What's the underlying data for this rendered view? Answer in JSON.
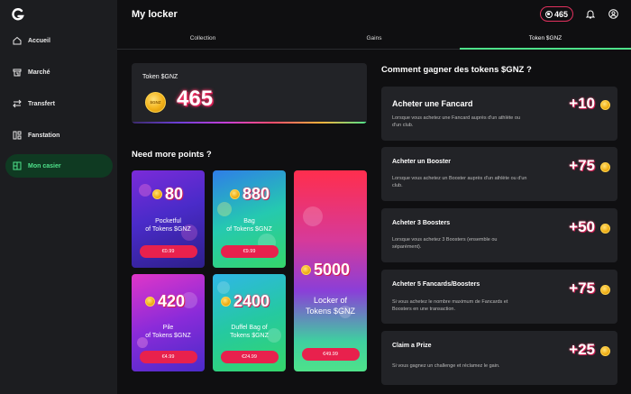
{
  "header": {
    "title": "My locker",
    "token_balance": "465"
  },
  "sidebar": {
    "items": [
      {
        "label": "Accueil",
        "icon": "home-icon"
      },
      {
        "label": "Marché",
        "icon": "market-icon"
      },
      {
        "label": "Transfert",
        "icon": "transfer-icon"
      },
      {
        "label": "Fanstation",
        "icon": "fanstation-icon"
      },
      {
        "label": "Mon casier",
        "icon": "locker-icon",
        "active": true
      }
    ]
  },
  "tabs": [
    {
      "label": "Collection"
    },
    {
      "label": "Gains"
    },
    {
      "label": "Token $GNZ",
      "active": true
    }
  ],
  "token_box": {
    "label": "Token $GNZ",
    "value": "465",
    "coin_text": "$GNZ"
  },
  "packs_title": "Need more points ?",
  "packs": [
    {
      "amount": "80",
      "name_line1": "Pocketful",
      "name_line2": "of Tokens $GNZ",
      "price": "€0.99"
    },
    {
      "amount": "880",
      "name_line1": "Bag",
      "name_line2": "of Tokens $GNZ",
      "price": "€9.99"
    },
    {
      "amount": "5000",
      "name_line1": "Locker of",
      "name_line2": "Tokens $GNZ",
      "price": "€49.99"
    },
    {
      "amount": "420",
      "name_line1": "Pile",
      "name_line2": "of Tokens $GNZ",
      "price": "€4.99"
    },
    {
      "amount": "2400",
      "name_line1": "Duffel Bag of",
      "name_line2": "Tokens $GNZ",
      "price": "€24.99"
    }
  ],
  "earn_title": "Comment gagner des tokens $GNZ ?",
  "earn": [
    {
      "title": "Acheter une Fancard",
      "desc": "Lorsque vous achetez une Fancard auprès d'un athlète ou d'un club.",
      "reward": "+10"
    },
    {
      "title": "Acheter un Booster",
      "desc": "Lorsque vous achetez un Booster auprès d'un athlète ou d'un club.",
      "reward": "+75"
    },
    {
      "title": "Acheter 3 Boosters",
      "desc": "Lorsque vous achetez 3 Boosters (ensemble ou séparément).",
      "reward": "+50"
    },
    {
      "title": "Acheter 5 Fancards/Boosters",
      "desc": "Si vous achetez le nombre maximum de Fancards et Boosters en une transaction.",
      "reward": "+75"
    },
    {
      "title": "Claim a Prize",
      "desc": "Si vous gagnez un challenge et réclamez le gain.",
      "reward": "+25"
    }
  ],
  "colors": {
    "accent_green": "#4ee28a",
    "accent_pink": "#e8214d",
    "background": "#0f0f11",
    "card": "#222327"
  }
}
